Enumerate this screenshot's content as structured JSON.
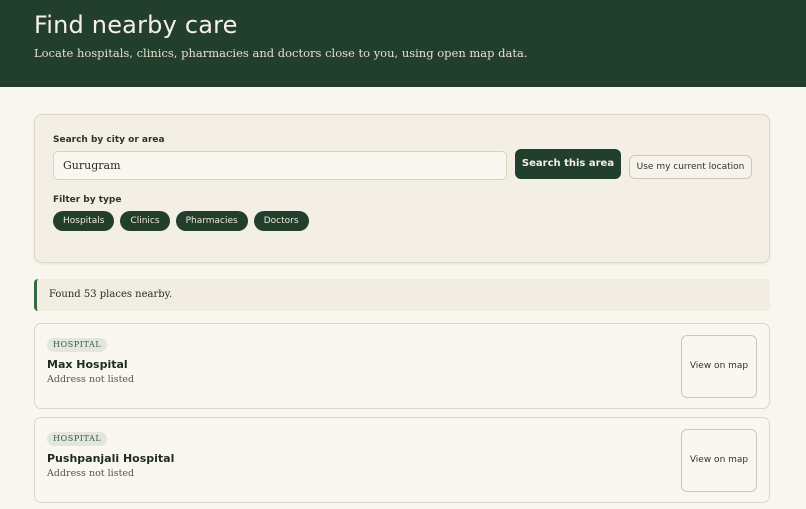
{
  "header": {
    "title": "Find nearby care",
    "subtitle": "Locate hospitals, clinics, pharmacies and doctors close to you, using open map data."
  },
  "search": {
    "label": "Search by city or area",
    "value": "Gurugram",
    "search_button": "Search this area",
    "location_button": "Use my current location"
  },
  "filter": {
    "label": "Filter by type",
    "chips": [
      "Hospitals",
      "Clinics",
      "Pharmacies",
      "Doctors"
    ]
  },
  "results": {
    "summary": "Found 53 places nearby.",
    "items": [
      {
        "type": "HOSPITAL",
        "name": "Max Hospital",
        "address": "Address not listed",
        "action": "View on map"
      },
      {
        "type": "HOSPITAL",
        "name": "Pushpanjali Hospital",
        "address": "Address not listed",
        "action": "View on map"
      }
    ]
  },
  "colors": {
    "brand": "#223f2e",
    "background": "#f9f6ef",
    "accent": "#2f6a45"
  }
}
